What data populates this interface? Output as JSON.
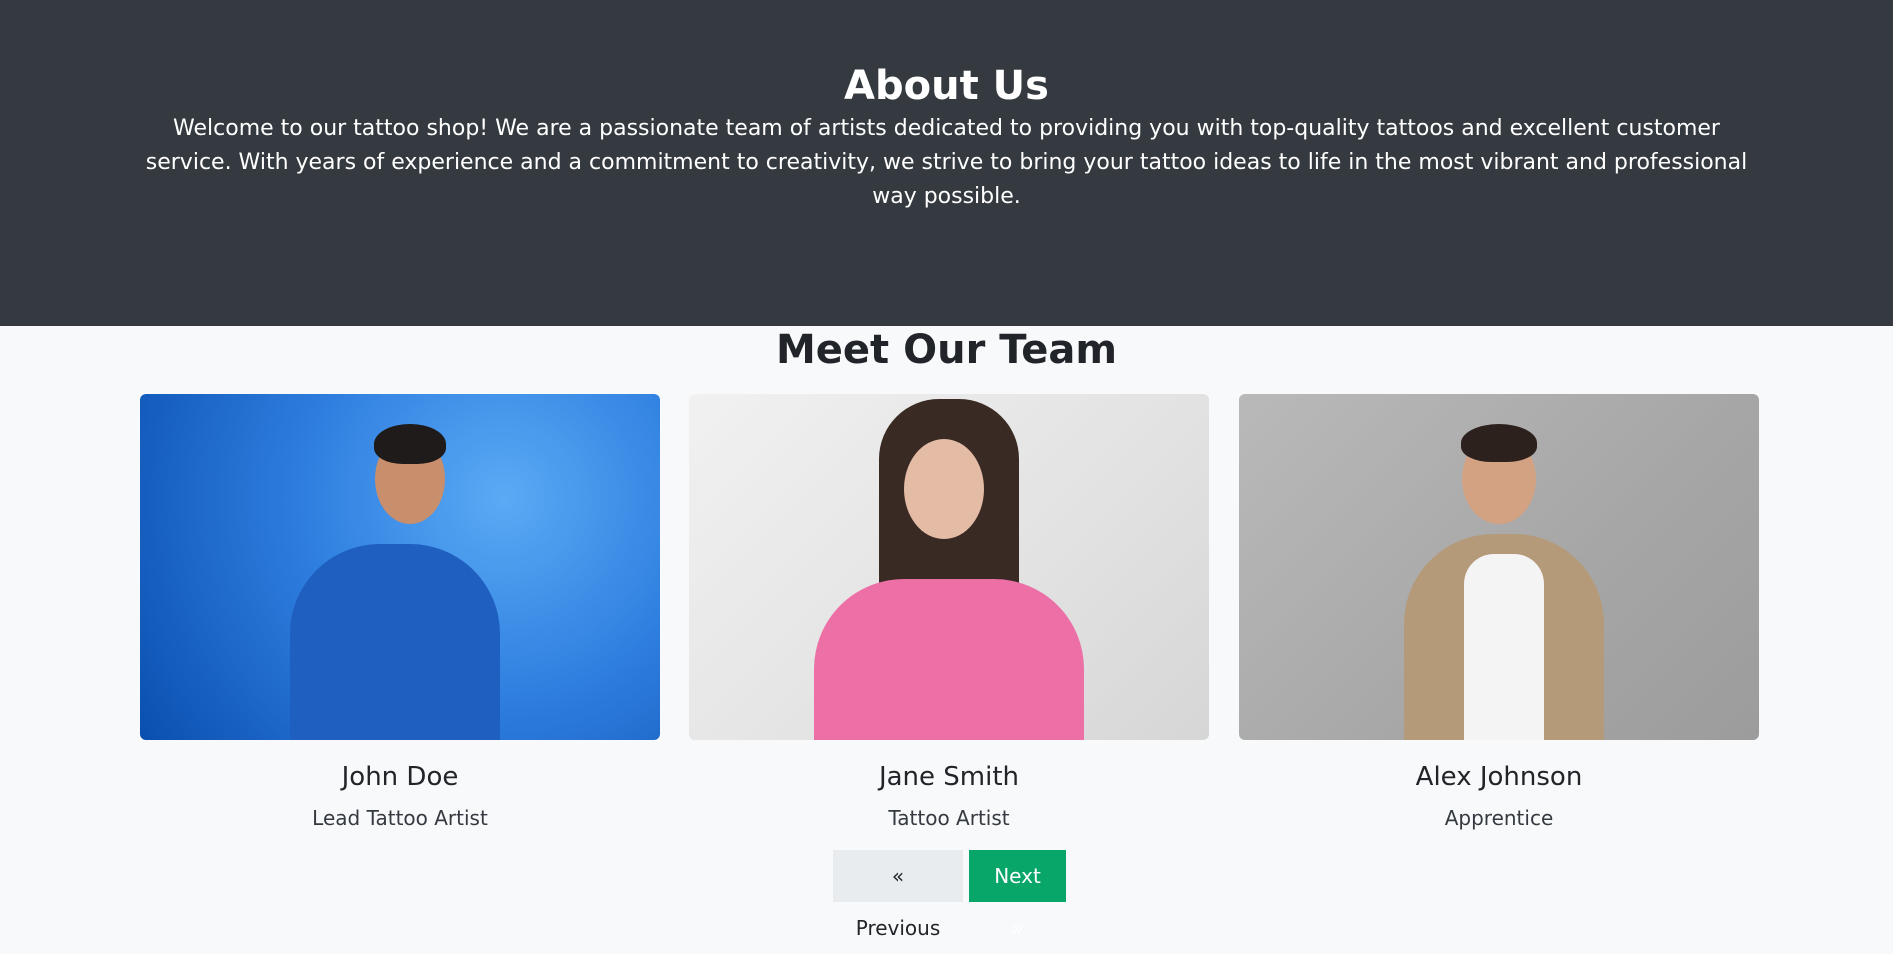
{
  "about": {
    "title": "About Us",
    "text": "Welcome to our tattoo shop! We are a passionate team of artists dedicated to providing you with top-quality tattoos and excellent customer service. With years of experience and a commitment to creativity, we strive to bring your tattoo ideas to life in the most vibrant and professional way possible."
  },
  "team": {
    "title": "Meet Our Team",
    "members": [
      {
        "name": "John Doe",
        "role": "Lead Tattoo Artist"
      },
      {
        "name": "Jane Smith",
        "role": "Tattoo Artist"
      },
      {
        "name": "Alex Johnson",
        "role": "Apprentice"
      }
    ]
  },
  "pagination": {
    "prev_label": "« Previous",
    "next_label": "Next »"
  },
  "colors": {
    "header_bg": "#343a40",
    "page_bg": "#f8f9fa",
    "next_button": "#09a66a"
  }
}
